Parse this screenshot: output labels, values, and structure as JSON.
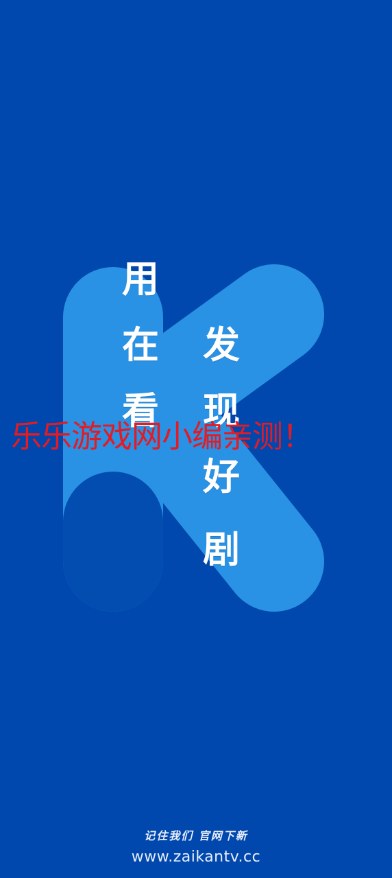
{
  "colors": {
    "background": "#0048ad",
    "logo": "#2a92e5",
    "slogan_text": "#ffffff",
    "watermark_text": "#e31b23",
    "footer_text": "#e8eefb"
  },
  "logo": {
    "icon": "k-logo-icon"
  },
  "slogan": {
    "left_column": [
      "用",
      "在",
      "看"
    ],
    "right_column": [
      "发",
      "现",
      "好",
      "剧"
    ]
  },
  "watermark": {
    "text": "乐乐游戏网小编亲测！"
  },
  "footer": {
    "tagline": "记住我们 官网下新",
    "url": "www.zaikantv.cc"
  }
}
